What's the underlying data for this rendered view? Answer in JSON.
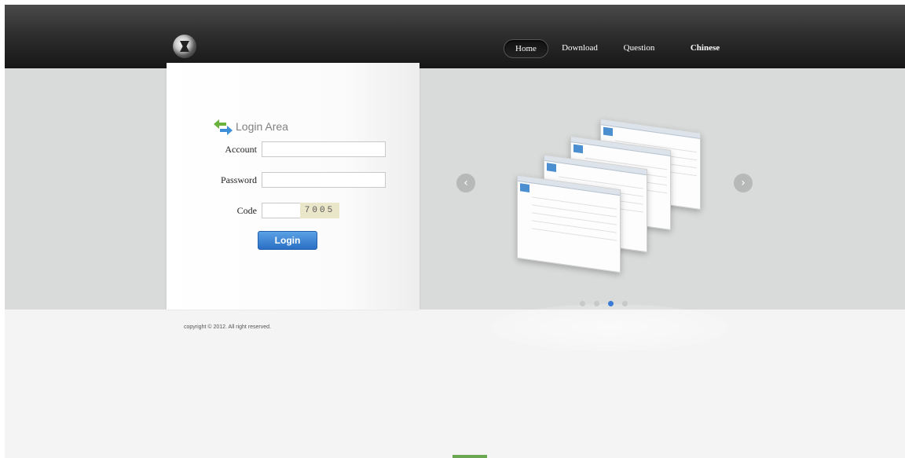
{
  "header": {
    "nav": [
      {
        "label": "Home",
        "active": true
      },
      {
        "label": "Download"
      },
      {
        "label": "Question"
      },
      {
        "label": "Chinese"
      }
    ]
  },
  "login": {
    "title": "Login Area",
    "account_label": "Account",
    "account_value": "",
    "password_label": "Password",
    "password_value": "",
    "code_label": "Code",
    "code_value": "",
    "captcha_text": "7005",
    "submit_label": "Login"
  },
  "carousel": {
    "prev_icon": "chevron-left-icon",
    "next_icon": "chevron-right-icon",
    "slide_count": 4,
    "active_index": 2
  },
  "footer": {
    "copyright": "copyright © 2012. All right reserved."
  },
  "colors": {
    "header_dark": "#161616",
    "band_gray": "#d9dbda",
    "accent_blue": "#3a7bd5",
    "green": "#6aa84f"
  }
}
